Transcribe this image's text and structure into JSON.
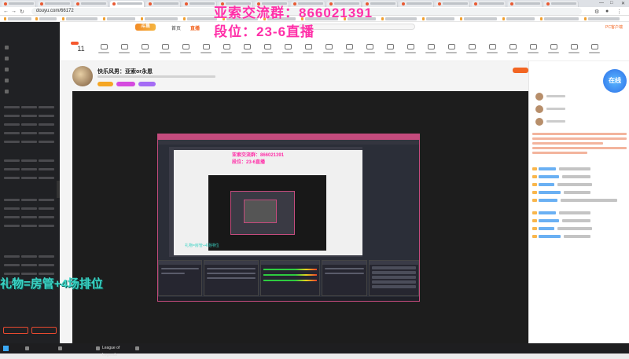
{
  "browser": {
    "url": "douyu.com/66172"
  },
  "topnav": {
    "logo": "斗鱼",
    "links": [
      "首页",
      "直播"
    ],
    "active_index": 1,
    "pc_client": "PC客户端"
  },
  "calendar": {
    "day": "11"
  },
  "room": {
    "title": "快乐风男：亚索or永恩"
  },
  "overlay": {
    "qq_group": "亚索交流群：866021391",
    "rank": "段位：23-6直播",
    "bottom": "礼物=房管+4场排位"
  },
  "obs_preview": {
    "qq_group": "亚索交流群：866021391",
    "rank": "段位：23-6直播",
    "bottom": "礼物=房管+4场排位"
  },
  "chat": {
    "live_bubble": "在线"
  },
  "taskbar": {
    "tasks": [
      "League of Legends"
    ]
  },
  "colors": {
    "accent": "#f26522",
    "overlay_pink": "#ff2fa8",
    "overlay_cyan": "#3ad3c4",
    "obs_frame": "#c44b7d"
  }
}
